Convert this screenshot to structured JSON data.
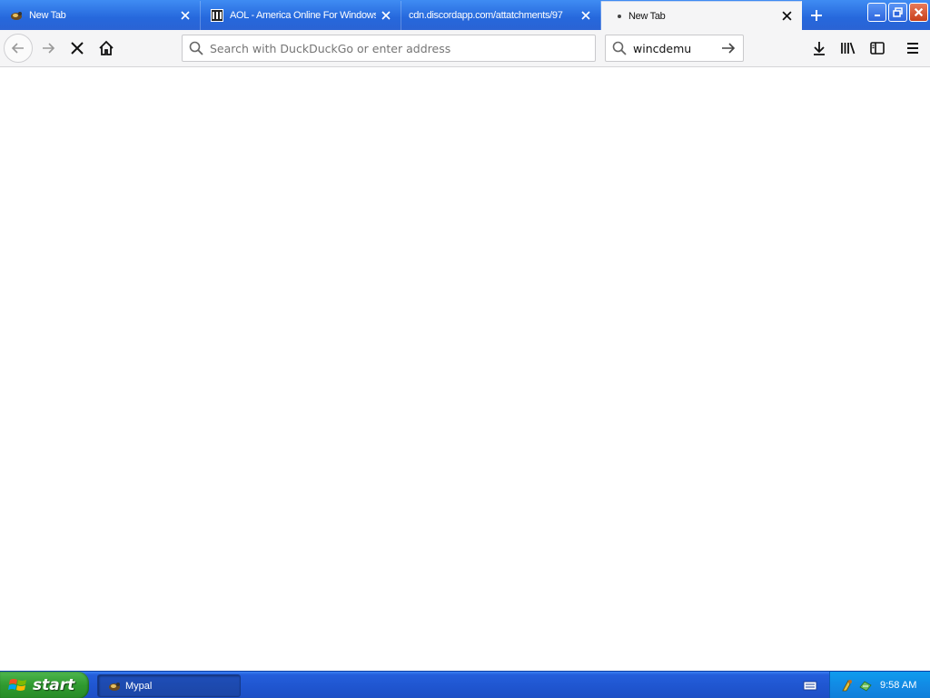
{
  "tabs": [
    {
      "title": "New Tab",
      "active": false
    },
    {
      "title": "AOL - America Online For Windows",
      "active": false
    },
    {
      "title": "cdn.discordapp.com/attatchments/97",
      "active": false
    },
    {
      "title": "New Tab",
      "active": true
    }
  ],
  "navbar": {
    "url_placeholder": "Search with DuckDuckGo or enter address",
    "search_value": "wincdemu"
  },
  "taskbar": {
    "start_label": "start",
    "task_label": "Mypal",
    "clock": "9:58 AM"
  },
  "colors": {
    "tab_strip": "#2668dc",
    "active_tab": "#f5f5f6",
    "start_green": "#2f9a2f",
    "tray_blue": "#1287e2"
  }
}
